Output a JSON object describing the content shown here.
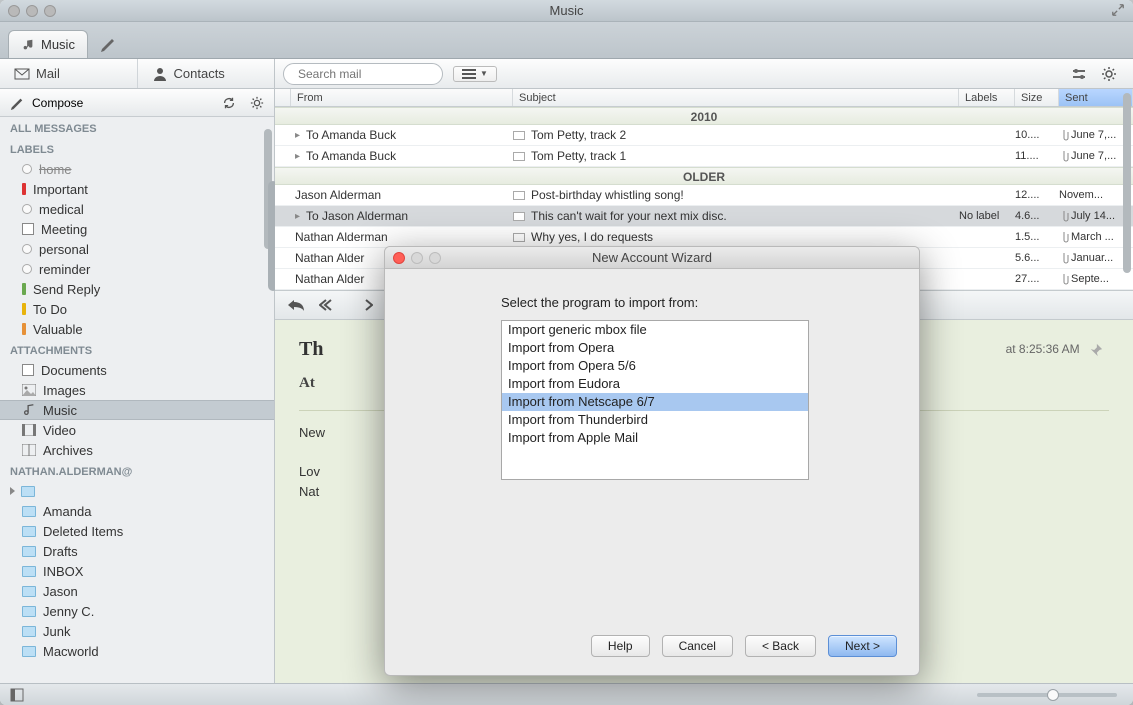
{
  "window": {
    "title": "Music"
  },
  "tab": {
    "label": "Music"
  },
  "sidebarTop": {
    "mail": "Mail",
    "contacts": "Contacts"
  },
  "search": {
    "placeholder": "Search mail"
  },
  "compose": {
    "label": "Compose"
  },
  "sections": {
    "allMessages": "ALL MESSAGES",
    "labels": "LABELS",
    "attachments": "ATTACHMENTS",
    "account": "NATHAN.ALDERMAN@"
  },
  "labels": {
    "home": "home",
    "important": "Important",
    "medical": "medical",
    "meeting": "Meeting",
    "personal": "personal",
    "reminder": "reminder",
    "sendReply": "Send Reply",
    "todo": "To Do",
    "valuable": "Valuable"
  },
  "attachCats": {
    "documents": "Documents",
    "images": "Images",
    "music": "Music",
    "video": "Video",
    "archives": "Archives"
  },
  "folders": [
    "Amanda",
    "Deleted Items",
    "Drafts",
    "INBOX",
    "Jason",
    "Jenny C.",
    "Junk",
    "Macworld"
  ],
  "columns": {
    "from": "From",
    "subject": "Subject",
    "labels": "Labels",
    "size": "Size",
    "sent": "Sent"
  },
  "groups": {
    "g2010": "2010",
    "older": "OLDER"
  },
  "messages": [
    {
      "to": true,
      "from": "To Amanda Buck",
      "subject": "Tom Petty, track 2",
      "labels": "",
      "size": "10....",
      "sent": "June 7,..."
    },
    {
      "to": true,
      "from": "To Amanda Buck",
      "subject": "Tom Petty, track 1",
      "labels": "",
      "size": "11....",
      "sent": "June 7,..."
    },
    {
      "to": false,
      "from": "Jason Alderman",
      "subject": "Post-birthday whistling song!",
      "labels": "",
      "size": "12....",
      "sent": "Novem..."
    },
    {
      "to": true,
      "from": "To Jason Alderman",
      "subject": "This can't wait for your next mix disc.",
      "labels": "No label",
      "size": "4.6...",
      "sent": "July 14..."
    },
    {
      "to": false,
      "from": "Nathan Alderman",
      "subject": "Why yes, I do requests",
      "labels": "",
      "size": "1.5...",
      "sent": "March ..."
    },
    {
      "to": false,
      "from": "Nathan Alder",
      "subject": "",
      "labels": "",
      "size": "5.6...",
      "sent": "Januar..."
    },
    {
      "to": false,
      "from": "Nathan Alder",
      "subject": "",
      "labels": "",
      "size": "27....",
      "sent": "Septe..."
    }
  ],
  "preview": {
    "titlePrefix": "Th",
    "timestamp": "at 8:25:36 AM",
    "attachLabel": "At",
    "body1": "New",
    "body2": "Lov",
    "body3": "Nat"
  },
  "modal": {
    "title": "New Account Wizard",
    "prompt": "Select the program to import from:",
    "options": [
      "Import generic mbox file",
      "Import from Opera",
      "Import from Opera 5/6",
      "Import from Eudora",
      "Import from Netscape 6/7",
      "Import from Thunderbird",
      "Import from Apple Mail"
    ],
    "help": "Help",
    "cancel": "Cancel",
    "back": "< Back",
    "next": "Next >"
  }
}
